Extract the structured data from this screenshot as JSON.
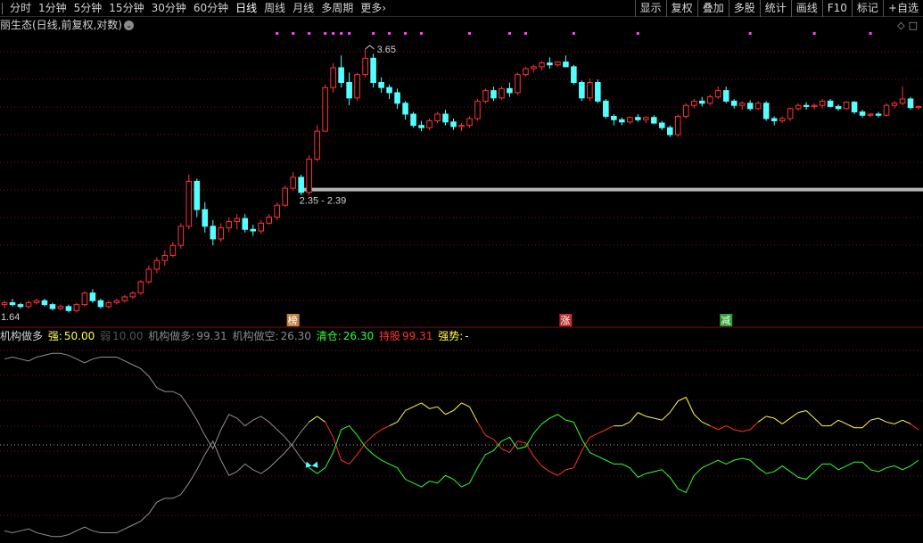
{
  "toolbar": {
    "periods": [
      "分时",
      "1分钟",
      "5分钟",
      "15分钟",
      "30分钟",
      "60分钟",
      "日线",
      "周线",
      "月线",
      "多周期",
      "更多"
    ],
    "active_period": "日线",
    "more_arrow": "›",
    "buttons": [
      "显示",
      "复权",
      "叠加",
      "多股",
      "统计",
      "画线",
      "F10",
      "标记",
      "+自选"
    ]
  },
  "chart_header": {
    "title": "丽生态(日线,前复权,对数)",
    "chevron": "⌄",
    "icons": [
      "diamond-icon",
      "panel-toggle-icon"
    ]
  },
  "price_labels": {
    "high": "3.65",
    "range": "2.35 - 2.39",
    "low": "1.64"
  },
  "markers": [
    {
      "text": "榜",
      "color": "#c08040",
      "index": 36
    },
    {
      "text": "涨",
      "color": "#c03030",
      "index": 70
    },
    {
      "text": "减",
      "color": "#30a030",
      "index": 90
    }
  ],
  "legend": {
    "name": "机构做多",
    "strong_label": "强:",
    "strong_value": "50.00",
    "weak_label": "弱",
    "weak_value": "10.00",
    "long_label": "机构做多:",
    "long_value": "99.31",
    "short_label": "机构做空:",
    "short_value": "26.30",
    "clear_label": "清仓:",
    "clear_value": "26.30",
    "hold_label": "持股",
    "hold_value": "99.31",
    "trend_label": "强势:",
    "trend_value": "-"
  },
  "colors": {
    "up": "#ff3232",
    "down": "#54ffff",
    "support": "#b4b4b4",
    "purple": "#ff44ff",
    "line_upper": "#ff3030",
    "line_yellow": "#ffff40",
    "line_lower": "#30ff30",
    "line_gray": "#909090",
    "grid": "#7a1010"
  },
  "chart_data": {
    "type": "candlestick",
    "ohlc": [
      [
        1.69,
        1.71,
        1.67,
        1.7
      ],
      [
        1.7,
        1.72,
        1.68,
        1.69
      ],
      [
        1.69,
        1.7,
        1.67,
        1.68
      ],
      [
        1.68,
        1.71,
        1.67,
        1.7
      ],
      [
        1.7,
        1.72,
        1.69,
        1.71
      ],
      [
        1.71,
        1.72,
        1.68,
        1.69
      ],
      [
        1.69,
        1.7,
        1.66,
        1.67
      ],
      [
        1.67,
        1.69,
        1.66,
        1.68
      ],
      [
        1.68,
        1.69,
        1.65,
        1.66
      ],
      [
        1.66,
        1.7,
        1.65,
        1.69
      ],
      [
        1.69,
        1.76,
        1.68,
        1.75
      ],
      [
        1.75,
        1.77,
        1.7,
        1.71
      ],
      [
        1.71,
        1.72,
        1.67,
        1.68
      ],
      [
        1.68,
        1.71,
        1.67,
        1.7
      ],
      [
        1.7,
        1.72,
        1.69,
        1.71
      ],
      [
        1.71,
        1.74,
        1.7,
        1.73
      ],
      [
        1.73,
        1.76,
        1.72,
        1.75
      ],
      [
        1.75,
        1.82,
        1.74,
        1.81
      ],
      [
        1.81,
        1.9,
        1.8,
        1.88
      ],
      [
        1.88,
        1.95,
        1.86,
        1.93
      ],
      [
        1.93,
        1.99,
        1.9,
        1.96
      ],
      [
        1.96,
        2.04,
        1.95,
        2.02
      ],
      [
        2.02,
        2.16,
        2.0,
        2.14
      ],
      [
        2.14,
        2.5,
        2.12,
        2.45
      ],
      [
        2.45,
        2.47,
        2.2,
        2.25
      ],
      [
        2.25,
        2.3,
        2.1,
        2.14
      ],
      [
        2.14,
        2.18,
        2.02,
        2.06
      ],
      [
        2.06,
        2.16,
        2.04,
        2.13
      ],
      [
        2.13,
        2.2,
        2.1,
        2.17
      ],
      [
        2.17,
        2.22,
        2.12,
        2.19
      ],
      [
        2.19,
        2.22,
        2.1,
        2.12
      ],
      [
        2.12,
        2.15,
        2.08,
        2.11
      ],
      [
        2.11,
        2.18,
        2.09,
        2.16
      ],
      [
        2.16,
        2.22,
        2.15,
        2.2
      ],
      [
        2.2,
        2.3,
        2.18,
        2.28
      ],
      [
        2.28,
        2.42,
        2.27,
        2.4
      ],
      [
        2.4,
        2.52,
        2.38,
        2.48
      ],
      [
        2.48,
        2.5,
        2.35,
        2.37
      ],
      [
        2.37,
        2.65,
        2.35,
        2.62
      ],
      [
        2.62,
        2.9,
        2.6,
        2.85
      ],
      [
        2.85,
        3.28,
        2.85,
        3.25
      ],
      [
        3.25,
        3.5,
        3.2,
        3.45
      ],
      [
        3.45,
        3.58,
        3.25,
        3.3
      ],
      [
        3.3,
        3.4,
        3.08,
        3.15
      ],
      [
        3.15,
        3.4,
        3.12,
        3.38
      ],
      [
        3.38,
        3.65,
        3.35,
        3.55
      ],
      [
        3.55,
        3.6,
        3.25,
        3.3
      ],
      [
        3.3,
        3.35,
        3.2,
        3.25
      ],
      [
        3.25,
        3.28,
        3.14,
        3.2
      ],
      [
        3.2,
        3.24,
        3.05,
        3.1
      ],
      [
        3.1,
        3.12,
        2.95,
        3.0
      ],
      [
        3.0,
        3.02,
        2.88,
        2.9
      ],
      [
        2.9,
        2.94,
        2.85,
        2.88
      ],
      [
        2.88,
        2.96,
        2.86,
        2.94
      ],
      [
        2.94,
        3.02,
        2.92,
        3.0
      ],
      [
        3.0,
        3.04,
        2.9,
        2.93
      ],
      [
        2.93,
        2.96,
        2.86,
        2.89
      ],
      [
        2.89,
        2.92,
        2.85,
        2.9
      ],
      [
        2.9,
        2.98,
        2.88,
        2.96
      ],
      [
        2.96,
        3.14,
        2.94,
        3.12
      ],
      [
        3.12,
        3.24,
        3.1,
        3.22
      ],
      [
        3.22,
        3.26,
        3.12,
        3.15
      ],
      [
        3.15,
        3.26,
        3.13,
        3.24
      ],
      [
        3.24,
        3.3,
        3.16,
        3.2
      ],
      [
        3.2,
        3.4,
        3.18,
        3.38
      ],
      [
        3.38,
        3.46,
        3.36,
        3.44
      ],
      [
        3.44,
        3.48,
        3.4,
        3.46
      ],
      [
        3.46,
        3.52,
        3.42,
        3.5
      ],
      [
        3.5,
        3.56,
        3.44,
        3.48
      ],
      [
        3.48,
        3.52,
        3.46,
        3.51
      ],
      [
        3.51,
        3.58,
        3.48,
        3.46
      ],
      [
        3.46,
        3.48,
        3.28,
        3.3
      ],
      [
        3.3,
        3.32,
        3.12,
        3.15
      ],
      [
        3.15,
        3.34,
        3.12,
        3.3
      ],
      [
        3.3,
        3.33,
        3.1,
        3.12
      ],
      [
        3.12,
        3.14,
        2.96,
        2.98
      ],
      [
        2.98,
        3.0,
        2.9,
        2.95
      ],
      [
        2.95,
        2.97,
        2.9,
        2.93
      ],
      [
        2.93,
        2.98,
        2.91,
        2.97
      ],
      [
        2.97,
        3.0,
        2.93,
        2.95
      ],
      [
        2.95,
        2.98,
        2.92,
        2.97
      ],
      [
        2.97,
        2.99,
        2.91,
        2.92
      ],
      [
        2.92,
        2.94,
        2.86,
        2.88
      ],
      [
        2.88,
        2.9,
        2.8,
        2.82
      ],
      [
        2.82,
        3.0,
        2.8,
        2.98
      ],
      [
        2.98,
        3.1,
        2.96,
        3.08
      ],
      [
        3.08,
        3.14,
        3.05,
        3.12
      ],
      [
        3.12,
        3.16,
        3.07,
        3.1
      ],
      [
        3.1,
        3.18,
        3.08,
        3.16
      ],
      [
        3.16,
        3.26,
        3.14,
        3.22
      ],
      [
        3.22,
        3.26,
        3.1,
        3.12
      ],
      [
        3.12,
        3.14,
        3.05,
        3.08
      ],
      [
        3.08,
        3.12,
        3.04,
        3.1
      ],
      [
        3.1,
        3.13,
        3.03,
        3.05
      ],
      [
        3.05,
        3.12,
        3.04,
        3.1
      ],
      [
        3.1,
        3.12,
        2.94,
        2.96
      ],
      [
        2.96,
        2.98,
        2.9,
        2.94
      ],
      [
        2.94,
        2.98,
        2.92,
        2.96
      ],
      [
        2.96,
        3.06,
        2.94,
        3.05
      ],
      [
        3.05,
        3.1,
        3.03,
        3.08
      ],
      [
        3.08,
        3.11,
        3.04,
        3.07
      ],
      [
        3.07,
        3.1,
        3.04,
        3.08
      ],
      [
        3.08,
        3.14,
        3.05,
        3.12
      ],
      [
        3.12,
        3.14,
        3.06,
        3.07
      ],
      [
        3.07,
        3.09,
        3.03,
        3.05
      ],
      [
        3.05,
        3.12,
        3.04,
        3.11
      ],
      [
        3.11,
        3.12,
        3.0,
        3.02
      ],
      [
        3.02,
        3.04,
        2.97,
        2.99
      ],
      [
        2.99,
        3.01,
        2.97,
        3.0
      ],
      [
        3.0,
        3.02,
        2.97,
        2.99
      ],
      [
        2.99,
        3.1,
        2.98,
        3.08
      ],
      [
        3.08,
        3.12,
        3.05,
        3.1
      ],
      [
        3.1,
        3.26,
        3.08,
        3.14
      ],
      [
        3.14,
        3.16,
        3.04,
        3.06
      ],
      [
        3.06,
        3.08,
        3.04,
        3.07
      ]
    ],
    "price_log_range": [
      1.6,
      3.8
    ],
    "support_level": 2.39,
    "indicator": {
      "ylim": [
        0,
        100
      ],
      "long_series": [
        95,
        96,
        95,
        94,
        96,
        97,
        98,
        98,
        97,
        95,
        93,
        95,
        96,
        96,
        96,
        94,
        92,
        90,
        86,
        80,
        78,
        78,
        76,
        70,
        63,
        55,
        48,
        58,
        66,
        64,
        60,
        63,
        65,
        62,
        58,
        54,
        49,
        43,
        38,
        35,
        38,
        46,
        58,
        60,
        55,
        49,
        45,
        42,
        40,
        38,
        32,
        30,
        28,
        31,
        30,
        34,
        32,
        28,
        30,
        38,
        45,
        47,
        52,
        54,
        48,
        49,
        56,
        61,
        64,
        66,
        63,
        62,
        53,
        46,
        44,
        42,
        40,
        40,
        38,
        33,
        35,
        36,
        37,
        33,
        27,
        25,
        34,
        38,
        40,
        42,
        40,
        42,
        43,
        42,
        38,
        35,
        36,
        39,
        36,
        33,
        32,
        36,
        40,
        40,
        37,
        39,
        41,
        41,
        37,
        36,
        38,
        39,
        37,
        39,
        42,
        36,
        33
      ],
      "short_series": [
        5,
        4,
        5,
        6,
        4,
        3,
        2,
        2,
        3,
        5,
        7,
        5,
        4,
        4,
        4,
        6,
        8,
        10,
        14,
        20,
        22,
        22,
        24,
        30,
        37,
        45,
        52,
        42,
        34,
        36,
        40,
        37,
        35,
        38,
        42,
        46,
        51,
        57,
        62,
        65,
        62,
        54,
        42,
        40,
        45,
        51,
        55,
        58,
        60,
        62,
        68,
        70,
        72,
        69,
        70,
        66,
        68,
        72,
        70,
        62,
        55,
        53,
        48,
        46,
        52,
        51,
        44,
        39,
        36,
        34,
        37,
        38,
        47,
        54,
        56,
        58,
        60,
        60,
        62,
        67,
        65,
        64,
        63,
        67,
        73,
        75,
        66,
        62,
        60,
        58,
        60,
        58,
        57,
        58,
        62,
        65,
        64,
        61,
        64,
        67,
        68,
        64,
        60,
        60,
        63,
        61,
        59,
        59,
        63,
        64,
        62,
        61,
        63,
        61,
        58,
        64,
        67
      ],
      "cross_index": 38,
      "strong_level": 50,
      "weak_level": 10
    }
  }
}
